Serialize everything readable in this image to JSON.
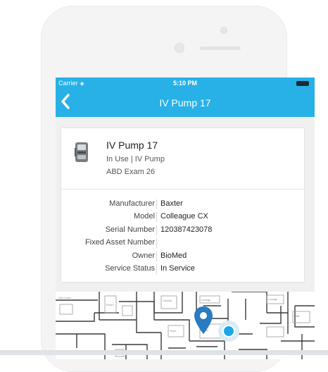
{
  "status_bar": {
    "carrier": "Carrier",
    "time": "5:10 PM"
  },
  "nav": {
    "title": "IV Pump 17",
    "back_icon": "chevron-left-icon"
  },
  "device": {
    "name": "IV Pump 17",
    "status": "In Use | IV Pump",
    "location": "ABD Exam 26",
    "icon": "iv-pump-icon"
  },
  "details": [
    {
      "label": "Manufacturer",
      "value": "Baxter"
    },
    {
      "label": "Model",
      "value": "Colleague CX"
    },
    {
      "label": "Serial Number",
      "value": "120387423078"
    },
    {
      "label": "Fixed Asset Number",
      "value": ""
    },
    {
      "label": "Owner",
      "value": "BioMed"
    },
    {
      "label": "Service Status",
      "value": "In Service"
    }
  ],
  "colors": {
    "header": "#27b1e6",
    "pin": "#2a7bbf",
    "dot": "#1ea6e6"
  }
}
